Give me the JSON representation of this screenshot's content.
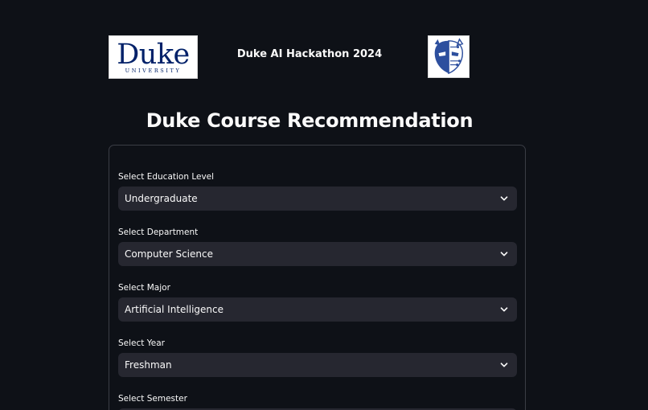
{
  "header": {
    "duke_logo_word": "Duke",
    "duke_logo_sub": "UNIVERSITY",
    "hackathon_title": "Duke AI Hackathon 2024"
  },
  "page_title": "Duke Course Recommendation",
  "form": {
    "fields": [
      {
        "label": "Select Education Level",
        "value": "Undergraduate"
      },
      {
        "label": "Select Department",
        "value": "Computer Science"
      },
      {
        "label": "Select Major",
        "value": "Artificial Intelligence"
      },
      {
        "label": "Select Year",
        "value": "Freshman"
      },
      {
        "label": "Select Semester",
        "value": ""
      }
    ]
  },
  "colors": {
    "background": "#0e1117",
    "select_bg": "#262730",
    "duke_blue": "#012169",
    "text": "#fafafa"
  },
  "icons": {
    "dropdown": "chevron-down-icon",
    "hackathon_logo": "mask-circuit-icon"
  }
}
